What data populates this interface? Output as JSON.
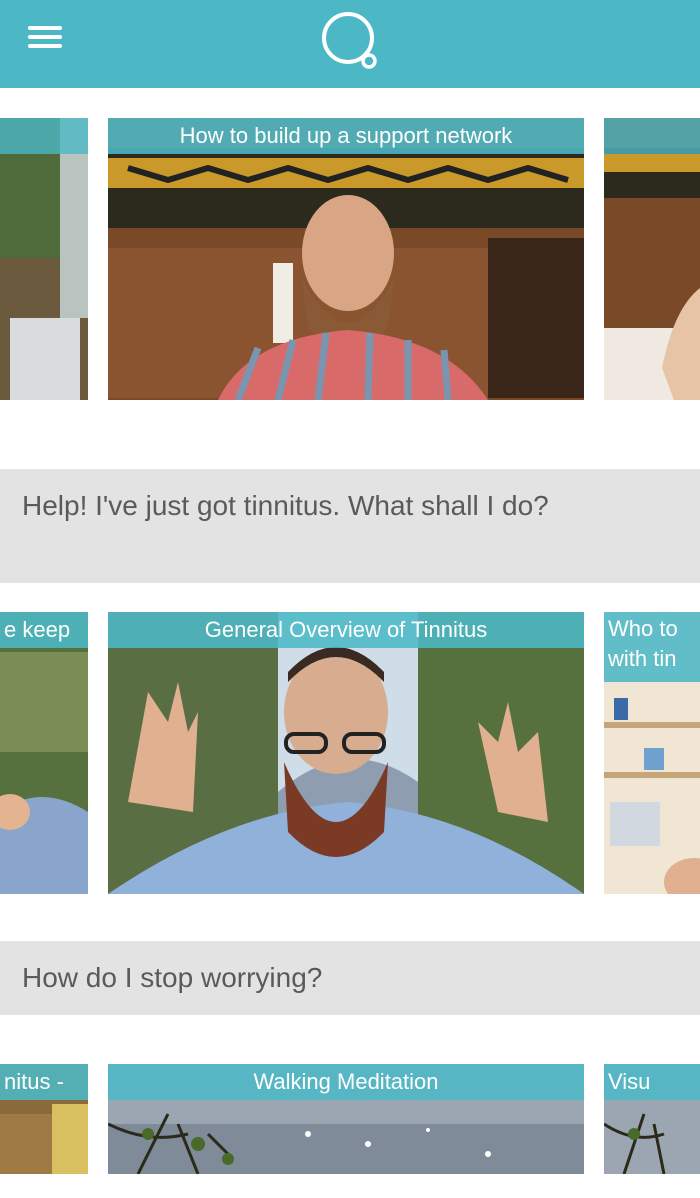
{
  "app": {
    "brand_color": "#4cb8c6",
    "menu_icon": "hamburger-icon",
    "logo_icon": "speech-bubble-logo-icon"
  },
  "rows": [
    {
      "cards": [
        {
          "label": ""
        },
        {
          "label": "How to build up a support network"
        },
        {
          "label": ""
        }
      ]
    },
    {
      "cards": [
        {
          "label": "e keep"
        },
        {
          "label": "General Overview of Tinnitus"
        },
        {
          "label": "Who to with tin"
        }
      ]
    },
    {
      "cards": [
        {
          "label": "nitus -"
        },
        {
          "label": "Walking Meditation"
        },
        {
          "label": "Visu"
        }
      ]
    }
  ],
  "sections": [
    {
      "title": "Help! I've just got tinnitus. What shall I do?"
    },
    {
      "title": "How do I stop worrying?"
    }
  ]
}
